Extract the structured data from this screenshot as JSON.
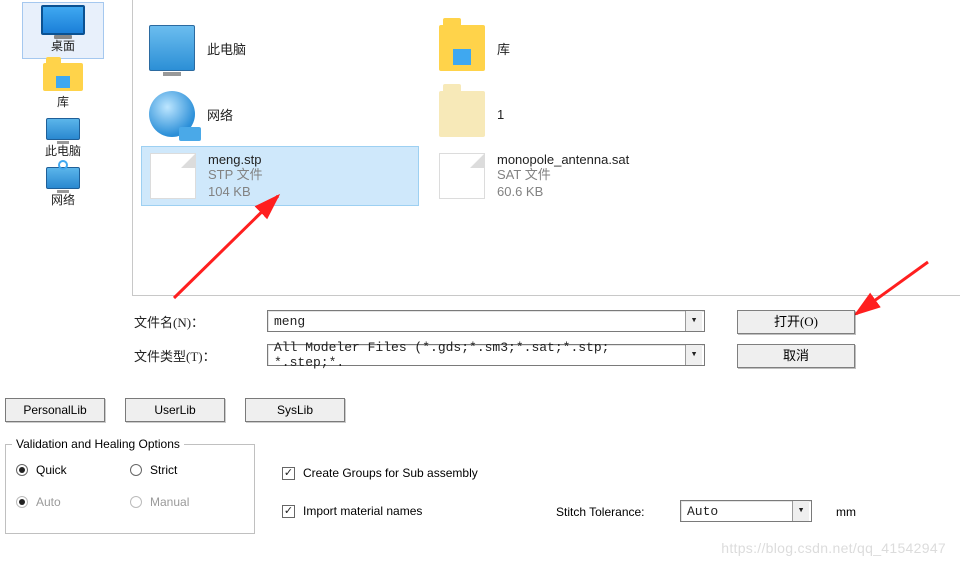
{
  "sidebar": {
    "items": [
      {
        "label": "桌面"
      },
      {
        "label": "库"
      },
      {
        "label": "此电脑"
      },
      {
        "label": "网络"
      }
    ]
  },
  "files": [
    {
      "name": "此电脑"
    },
    {
      "name": "网络"
    },
    {
      "name": "meng.stp",
      "type": "STP 文件",
      "size": "104 KB"
    },
    {
      "name": "库"
    },
    {
      "name": "1"
    },
    {
      "name": "monopole_antenna.sat",
      "type": "SAT 文件",
      "size": "60.6 KB"
    }
  ],
  "filename_label": "文件名(N)：",
  "filetype_label": "文件类型(T)：",
  "filename_value": "meng",
  "filetype_value": "All Modeler Files (*.gds;*.sm3;*.sat;*.stp; *.step;*.",
  "buttons": {
    "open": "打开(O)",
    "cancel": "取消"
  },
  "tabs": {
    "personal": "PersonalLib",
    "user": "UserLib",
    "sys": "SysLib"
  },
  "group_title": "Validation and Healing Options",
  "radio": {
    "quick": "Quick",
    "strict": "Strict",
    "auto": "Auto",
    "manual": "Manual"
  },
  "chk_groups": "Create Groups for Sub assembly",
  "chk_materials": "Import material names",
  "stitch_label": "Stitch Tolerance:",
  "stitch_value": "Auto",
  "stitch_unit": "mm",
  "watermark": "https://blog.csdn.net/qq_41542947"
}
